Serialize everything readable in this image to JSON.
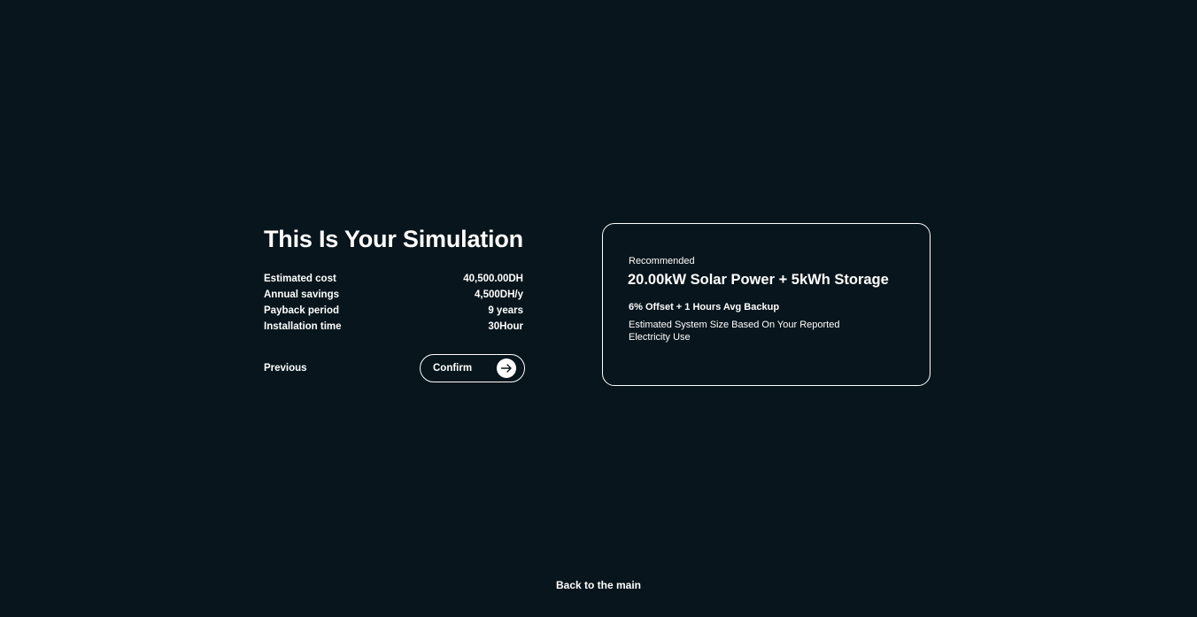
{
  "simulation": {
    "title": "This Is Your Simulation",
    "stats": [
      {
        "label": "Estimated cost",
        "value": "40,500.00DH"
      },
      {
        "label": "Annual savings",
        "value": "4,500DH/y"
      },
      {
        "label": "Payback period",
        "value": "9 years"
      },
      {
        "label": "Installation time",
        "value": "30Hour"
      }
    ],
    "previous_label": "Previous",
    "confirm_label": "Confirm",
    "confirm_icon": "arrow-right-icon"
  },
  "recommendation": {
    "eyebrow": "Recommended",
    "title": "20.00kW Solar Power + 5kWh Storage",
    "subtitle": "6% Offset + 1 Hours Avg Backup",
    "description": "Estimated System Size Based On Your Reported Electricity Use"
  },
  "footer": {
    "back_label": "Back to the main"
  },
  "colors": {
    "background": "#08151c",
    "foreground": "#ffffff"
  }
}
